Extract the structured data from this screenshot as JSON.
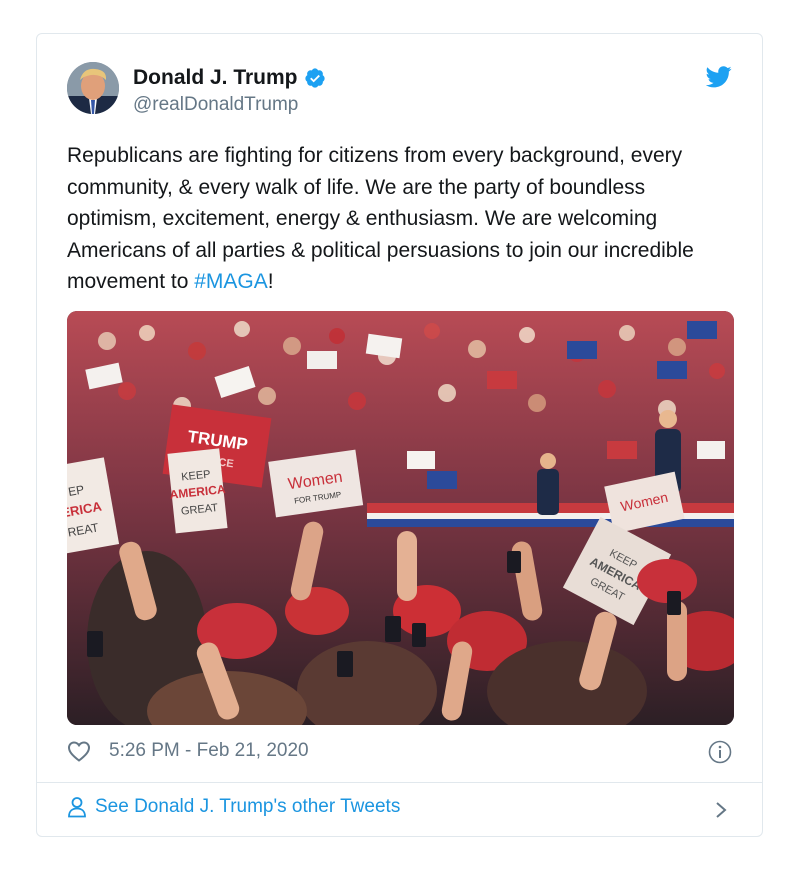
{
  "tweet": {
    "author_name": "Donald J. Trump",
    "author_handle": "@realDonaldTrump",
    "text_before": "Republicans are fighting for citizens from every background, every community, & every walk of life. We are the party of boundless optimism, excitement, energy & enthusiasm. We are welcoming Americans of all parties & political persuasions to join our incredible movement to ",
    "hashtag": "#MAGA",
    "text_after": "!",
    "timestamp": "5:26 PM - Feb 21, 2020",
    "footer_label": "See Donald J. Trump's other Tweets"
  },
  "photo": {
    "signs": [
      "TRUMP",
      "PENCE",
      "Women",
      "FOR TRUMP",
      "KEEP",
      "AMERICA",
      "GREAT",
      "EP",
      "ERICA",
      "REAT"
    ]
  },
  "icons": {
    "verified": "verified-badge-icon",
    "bird": "twitter-bird-icon",
    "heart": "heart-icon",
    "info": "info-icon",
    "person": "person-icon",
    "chevron": "chevron-right-icon"
  },
  "colors": {
    "accent": "#1b95e0",
    "secondary_text": "#657786",
    "border": "#e1e8ed"
  }
}
